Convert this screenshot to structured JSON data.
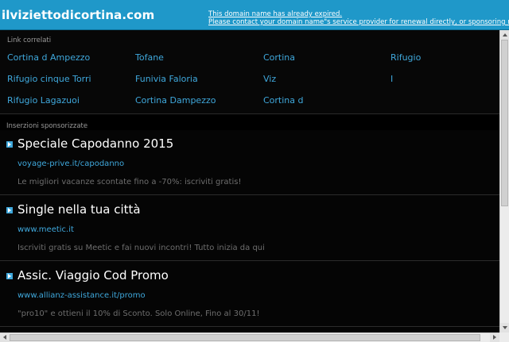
{
  "header": {
    "domain": "ilviziettodicortina.com",
    "notice_line1": "This domain name has already expired.",
    "notice_line2": "Please contact your domain name\"s service provider for renewal directly, or sponsoring registrar if ne",
    "background_color": "#1f98c9"
  },
  "related": {
    "heading": "Link correlati",
    "links": [
      "Cortina d Ampezzo",
      "Tofane",
      "Cortina",
      "Rifugio",
      "Rifugio cinque Torri",
      "Funivia Faloria",
      "Viz",
      "I",
      "Rifugio Lagazuoi",
      "Cortina Dampezzo",
      "Cortina d"
    ]
  },
  "sponsored": {
    "heading": "Inserzioni sponsorizzate",
    "ads": [
      {
        "title": "Speciale Capodanno 2015",
        "url": "voyage-prive.it/capodanno",
        "description": "Le migliori vacanze scontate fino a -70%: iscriviti gratis!"
      },
      {
        "title": "Single nella tua città",
        "url": "www.meetic.it",
        "description": "Iscriviti gratis su Meetic e fai nuovi incontri! Tutto inizia da qui"
      },
      {
        "title": "Assic. Viaggio Cod Promo",
        "url": "www.allianz-assistance.it/promo",
        "description": "\"pro10\" e ottieni il 10% di Sconto. Solo Online, Fino al 30/11!"
      }
    ]
  },
  "colors": {
    "link": "#3fa8dc",
    "background": "#000000"
  }
}
